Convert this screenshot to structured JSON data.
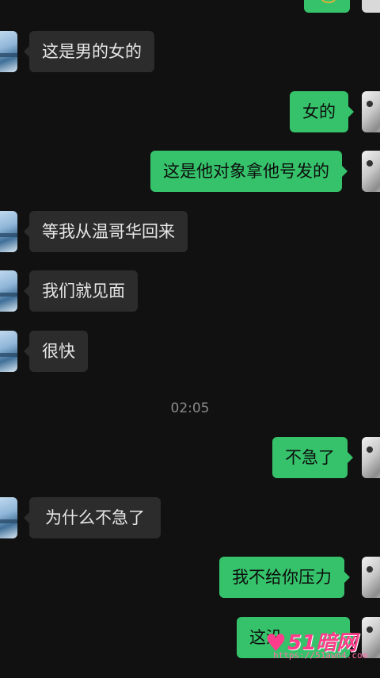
{
  "messages": [
    {
      "side": "in",
      "text": "这是男的女的"
    },
    {
      "side": "out",
      "text": "女的"
    },
    {
      "side": "out",
      "text": "这是他对象拿他号发的"
    },
    {
      "side": "in",
      "text": "等我从温哥华回来"
    },
    {
      "side": "in",
      "text": "我们就见面"
    },
    {
      "side": "in",
      "text": "很快"
    },
    {
      "side": "out",
      "text": "不急了"
    },
    {
      "side": "in",
      "text": "为什么不急了"
    },
    {
      "side": "out",
      "text": "我不给你压力"
    },
    {
      "side": "out",
      "text": "这没"
    }
  ],
  "timestamp": "02:05",
  "watermark": {
    "logo_text": "51暗网",
    "url": "https://51awn4.com"
  },
  "colors": {
    "background": "#111111",
    "incoming_bubble": "#2c2c2c",
    "outgoing_bubble": "#35c26a",
    "timestamp_text": "#8a8a8a",
    "watermark": "#ff3d8b"
  },
  "icons": {
    "watermark_mark": "heart-icon"
  }
}
